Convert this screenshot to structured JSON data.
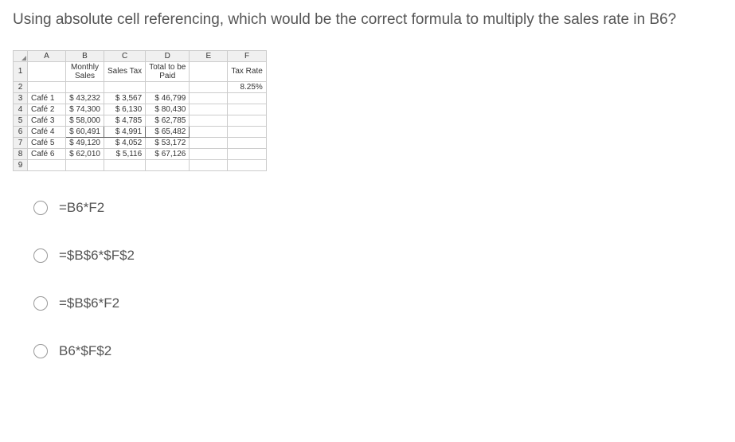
{
  "question": "Using absolute cell referencing, which would be the correct formula to multiply the sales rate in B6?",
  "columns": [
    "A",
    "B",
    "C",
    "D",
    "E",
    "F"
  ],
  "headers": {
    "monthly_sales": "Monthly Sales",
    "sales_tax": "Sales Tax",
    "total_paid": "Total to be Paid",
    "tax_rate_label": "Tax Rate",
    "tax_rate_value": "8.25%"
  },
  "rows": [
    {
      "label": "Café 1",
      "sales": "$   43,232",
      "tax": "$   3,567",
      "total": "$   46,799"
    },
    {
      "label": "Café 2",
      "sales": "$   74,300",
      "tax": "$   6,130",
      "total": "$   80,430"
    },
    {
      "label": "Café 3",
      "sales": "$   58,000",
      "tax": "$   4,785",
      "total": "$   62,785"
    },
    {
      "label": "Café 4",
      "sales": "$   60,491",
      "tax": "$   4,991",
      "total": "$   65,482"
    },
    {
      "label": "Café 5",
      "sales": "$   49,120",
      "tax": "$   4,052",
      "total": "$   53,172"
    },
    {
      "label": "Café 6",
      "sales": "$   62,010",
      "tax": "$   5,116",
      "total": "$   67,126"
    }
  ],
  "row_numbers": [
    "1",
    "2",
    "3",
    "4",
    "5",
    "6",
    "7",
    "8",
    "9"
  ],
  "options": [
    "=B6*F2",
    "=$B$6*$F$2",
    "=$B$6*F2",
    "B6*$F$2"
  ]
}
